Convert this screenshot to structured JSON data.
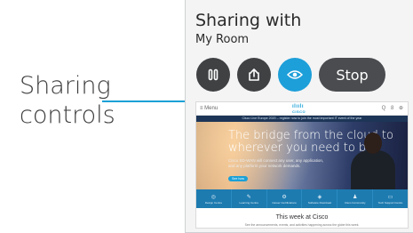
{
  "callout": {
    "line1": "Sharing",
    "line2": "controls",
    "accent_color": "#19a1d6"
  },
  "panel": {
    "title": "Sharing with",
    "room": "My Room"
  },
  "controls": {
    "pause_icon": "pause-icon",
    "share_icon": "share-upload-icon",
    "view_icon": "eye-icon",
    "stop_label": "Stop",
    "view_color": "#1d9fd9"
  },
  "preview": {
    "nav": {
      "menu_label": "≡ Menu",
      "logo_text": "ılıılı",
      "logo_word": "CISCO",
      "right_icons": "Q 8 ⊕"
    },
    "banner_text": "Cisco Live Europe 2020 – register now to join the most important IT event of the year",
    "hero": {
      "headline_line1": "The bridge from the cloud to",
      "headline_line2": "wherever you need to be",
      "subtext": "Cisco SD-WAN will connect any user, any application, and any platform your network demands.",
      "cta": "See how"
    },
    "tiles": [
      {
        "icon": "◎",
        "label": "Design Centre"
      },
      {
        "icon": "✎",
        "label": "Learning Centre"
      },
      {
        "icon": "⚙",
        "label": "Career Certifications"
      },
      {
        "icon": "◈",
        "label": "Software Download"
      },
      {
        "icon": "♟",
        "label": "Cisco Community"
      },
      {
        "icon": "▭",
        "label": "Tech Support Centre"
      }
    ],
    "week_title": "This week at Cisco",
    "week_sub": "See the announcements, events, and activities happening across the globe this week."
  }
}
